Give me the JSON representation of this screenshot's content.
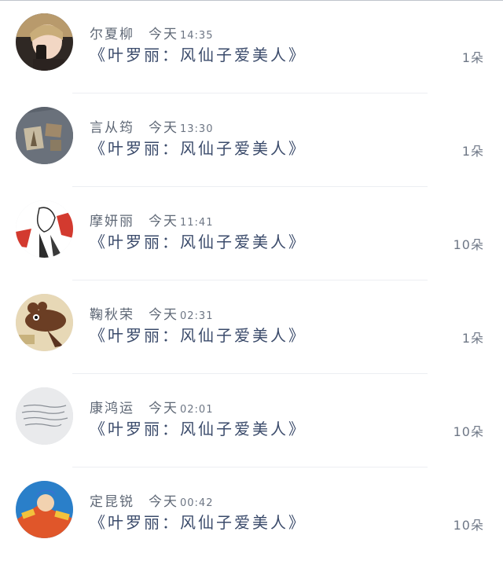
{
  "feed": {
    "items": [
      {
        "name": "尔夏柳",
        "day": "今天",
        "time": "14:35",
        "title": "《叶罗丽：风仙子爱美人》",
        "count": "1朵",
        "avatar_icon": "portrait-photo",
        "avatar_colors": [
          "#3a2e27",
          "#b89a6c",
          "#f2d7c4"
        ]
      },
      {
        "name": "言从筠",
        "day": "今天",
        "time": "13:30",
        "title": "《叶罗丽：风仙子爱美人》",
        "count": "1朵",
        "avatar_icon": "paris-postcard-photo",
        "avatar_colors": [
          "#5c636d",
          "#b2a58a",
          "#8a7b62"
        ]
      },
      {
        "name": "摩妍丽",
        "day": "今天",
        "time": "11:41",
        "title": "《叶罗丽：风仙子爱美人》",
        "count": "10朵",
        "avatar_icon": "anime-sketch-illustration",
        "avatar_colors": [
          "#ffffff",
          "#d33a2f",
          "#2c2c2c"
        ]
      },
      {
        "name": "鞠秋荣",
        "day": "今天",
        "time": "02:31",
        "title": "《叶罗丽：风仙子爱美人》",
        "count": "1朵",
        "avatar_icon": "cartoon-mouse-art",
        "avatar_colors": [
          "#e7d8b6",
          "#6b3e24",
          "#c8b27d"
        ]
      },
      {
        "name": "康鸿运",
        "day": "今天",
        "time": "02:01",
        "title": "《叶罗丽：风仙子爱美人》",
        "count": "10朵",
        "avatar_icon": "handwritten-note-photo",
        "avatar_colors": [
          "#e9eaec",
          "#8a8f96",
          "#c9ccd1"
        ]
      },
      {
        "name": "定昆锐",
        "day": "今天",
        "time": "00:42",
        "title": "《叶罗丽：风仙子爱美人》",
        "count": "10朵",
        "avatar_icon": "game-character-art",
        "avatar_colors": [
          "#2a7fc9",
          "#e0562a",
          "#f2c23c"
        ]
      }
    ]
  }
}
